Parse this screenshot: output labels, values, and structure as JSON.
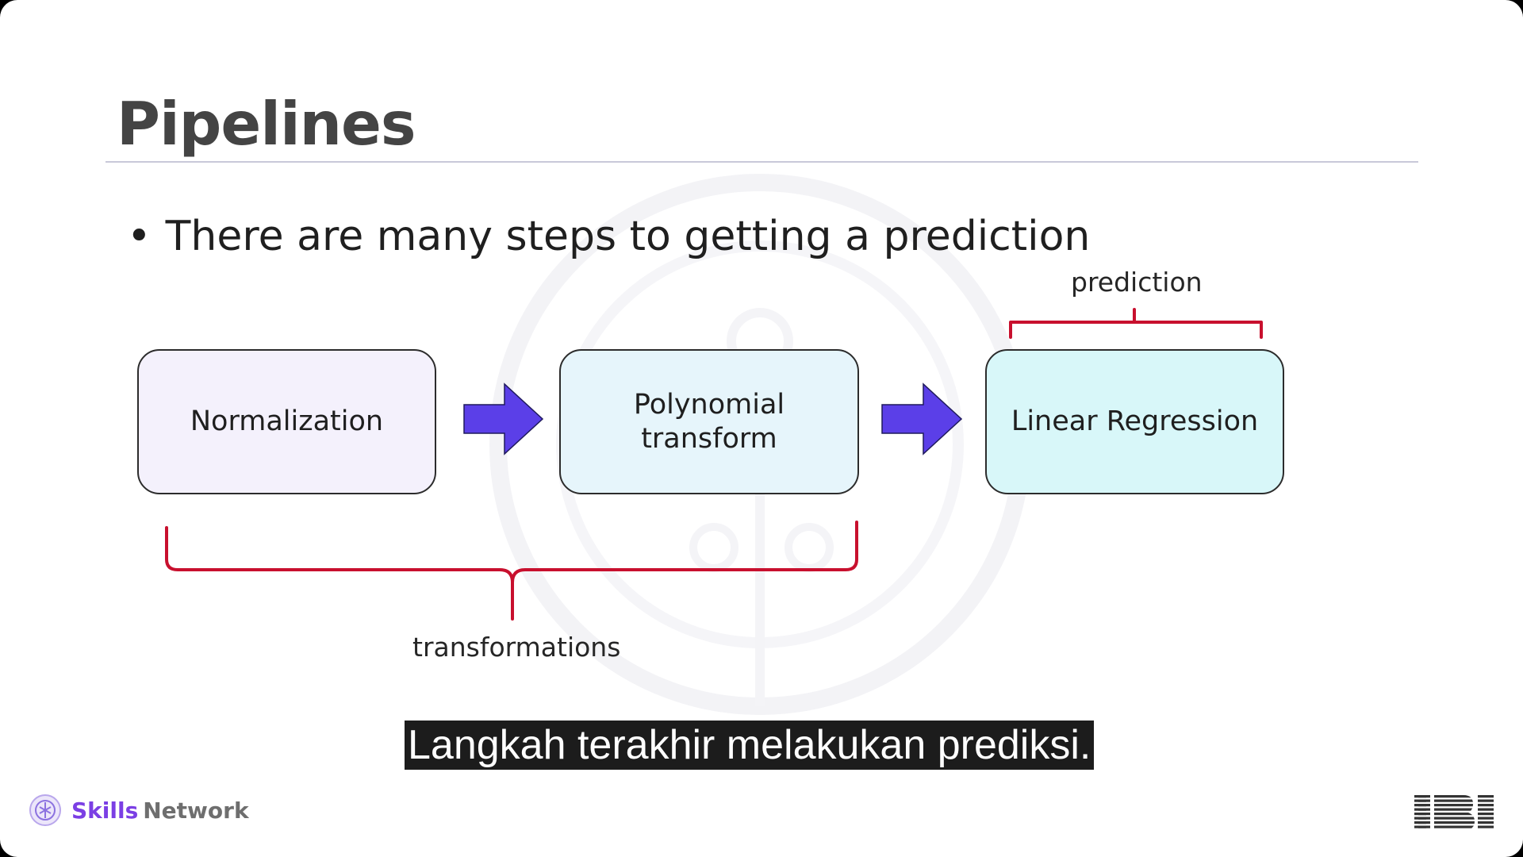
{
  "slide": {
    "title": "Pipelines",
    "bullet": "There are many steps to getting a prediction"
  },
  "diagram": {
    "boxes": [
      {
        "label": "Normalization",
        "fill": "#f4f1fc"
      },
      {
        "label": "Polynomial\ntransform",
        "fill": "#e6f5fb"
      },
      {
        "label": "Linear Regression",
        "fill": "#d8f7f9"
      }
    ],
    "labels": {
      "prediction": "prediction",
      "transformations": "transformations"
    },
    "arrow_color": "#5b3fe8",
    "brace_color": "#c8102e"
  },
  "subtitle": {
    "text": "Langkah terakhir melakukan prediksi."
  },
  "footer": {
    "brand_skills": "Skills",
    "brand_network": "Network",
    "brand_color": "#7b3fe4",
    "logo_icon": "skills-network-logo-icon",
    "ibm_icon": "ibm-logo"
  }
}
